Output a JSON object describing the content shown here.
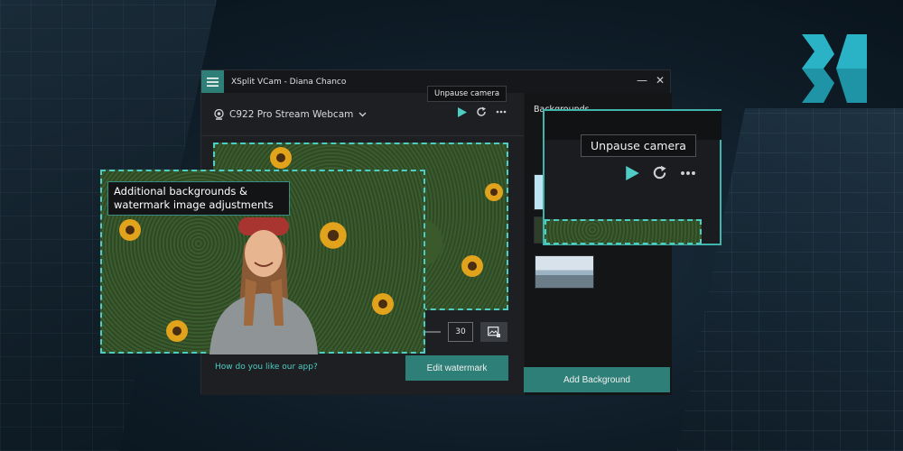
{
  "window": {
    "title": "XSplit VCam - Diana Chanco",
    "minimize_glyph": "—",
    "close_glyph": "✕"
  },
  "camera": {
    "selected": "C922 Pro Stream Webcam"
  },
  "tooltip": {
    "unpause": "Unpause camera"
  },
  "controls": {
    "value": "30",
    "feedback_link": "How do you like our app?",
    "edit_watermark_label": "Edit watermark"
  },
  "backgrounds": {
    "heading": "Backgrounds",
    "add_label": "Add Background"
  },
  "callouts": {
    "left_line1": "Additional backgrounds &",
    "left_line2": "watermark image adjustments",
    "right_tooltip": "Unpause camera"
  },
  "colors": {
    "accent": "#2e7f77",
    "highlight": "#4ecdc4",
    "logo": "#2ab3c6"
  },
  "icons": [
    "menu-icon",
    "webcam-icon",
    "chevron-down-icon",
    "play-icon",
    "refresh-icon",
    "more-icon",
    "image-edit-icon",
    "xsplit-logo-icon"
  ]
}
